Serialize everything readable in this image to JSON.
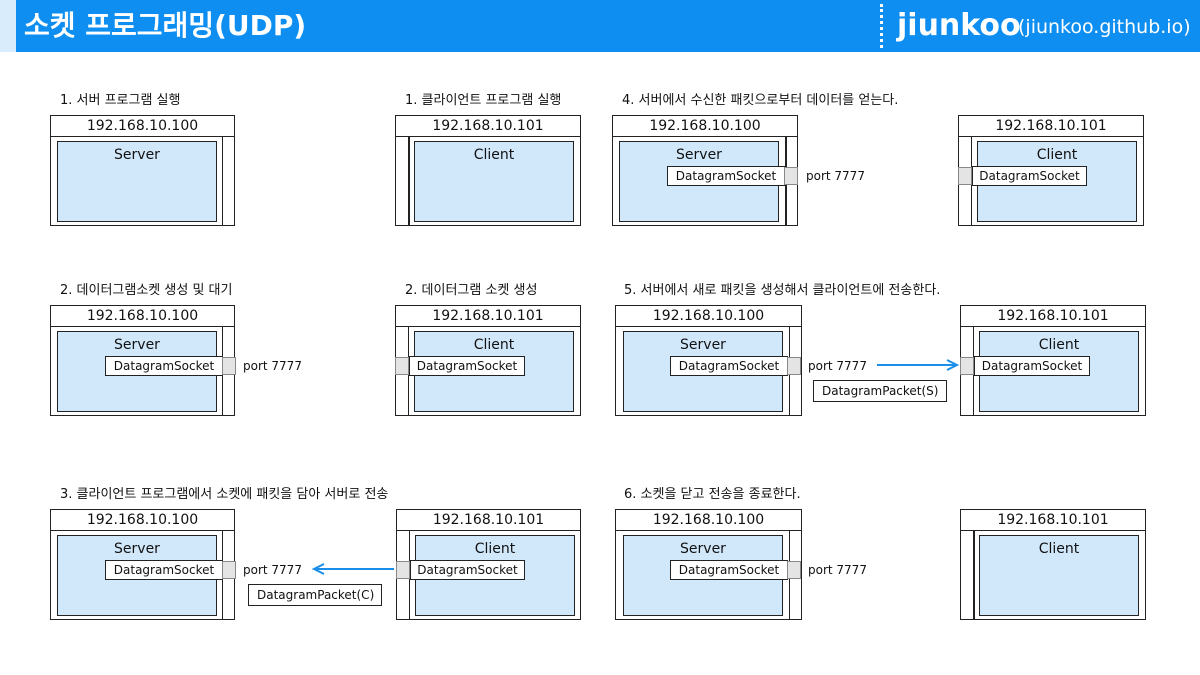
{
  "header": {
    "title": "소켓 프로그래밍(UDP)",
    "brand": "jiunkoo",
    "brand_url": "(jiunkoo.github.io)"
  },
  "colors": {
    "header_blue": "#0d8ef0",
    "app_fill": "#d1e8fb",
    "arrow": "#1a8ee8",
    "port_fill": "#e4e4e4"
  },
  "labels": {
    "server_ip": "192.168.10.100",
    "client_ip": "192.168.10.101",
    "server": "Server",
    "client": "Client",
    "socket": "DatagramSocket",
    "port": "port 7777",
    "packet_c": "DatagramPacket(C)",
    "packet_s": "DatagramPacket(S)"
  },
  "steps": {
    "s1_server": "1. 서버 프로그램 실행",
    "s1_client": "1. 클라이언트 프로그램 실행",
    "s2_server": "2. 데이터그램소켓 생성 및 대기",
    "s2_client": "2. 데이터그램 소켓 생성",
    "s3": "3. 클라이언트 프로그램에서 소켓에 패킷을 담아 서버로 전송",
    "s4": "4. 서버에서 수신한 패킷으로부터 데이터를 얻는다.",
    "s5": "5. 서버에서 새로 패킷을 생성해서 클라이언트에 전송한다.",
    "s6": "6. 소켓을 닫고 전송을 종료한다."
  }
}
